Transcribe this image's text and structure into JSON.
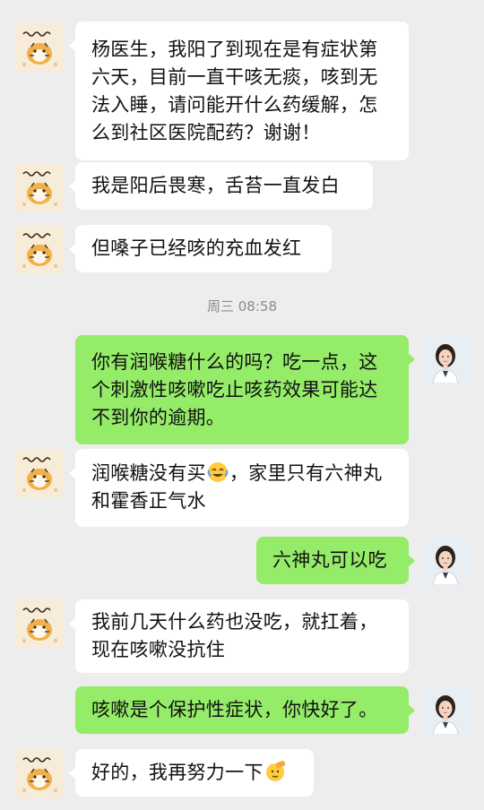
{
  "timestamp": "周三 08:58",
  "messages": [
    {
      "side": "in",
      "text": "杨医生，我阳了到现在是有症状第六天，目前一直干咳无痰，咳到无法入睡，请问能开什么药缓解，怎么到社区医院配药？谢谢！"
    },
    {
      "side": "in",
      "text": "我是阳后畏寒，舌苔一直发白"
    },
    {
      "side": "in",
      "text": "但嗓子已经咳的充血发红"
    },
    {
      "side": "out",
      "text": "你有润喉糖什么的吗？吃一点，这个刺激性咳嗽吃止咳药效果可能达不到你的逾期。"
    },
    {
      "side": "in",
      "text_a": "润喉糖没有买",
      "emoji": "laughing-crying-emoji",
      "text_b": "，家里只有六神丸和霍香正气水"
    },
    {
      "side": "out",
      "text": "六神丸可以吃"
    },
    {
      "side": "in",
      "text": "我前几天什么药也没吃，就扛着，现在咳嗽没抗住"
    },
    {
      "side": "out",
      "text": "咳嗽是个保护性症状，你快好了。"
    },
    {
      "side": "in",
      "text": "好的，我再努力一下",
      "emoji": "saluting-face-emoji"
    }
  ],
  "colors": {
    "background": "#ededed",
    "incoming_bubble": "#ffffff",
    "outgoing_bubble": "#95ec69",
    "timestamp_text": "#8c8c8c"
  }
}
